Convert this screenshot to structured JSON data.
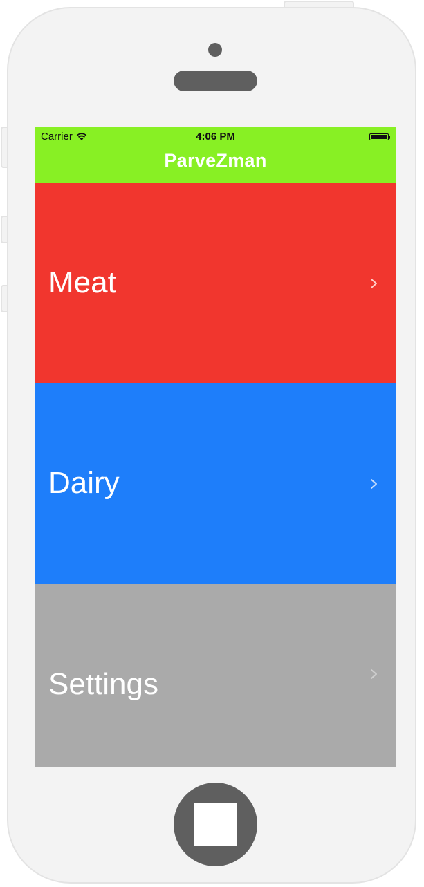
{
  "status_bar": {
    "carrier": "Carrier",
    "time": "4:06 PM",
    "wifi_icon": "wifi-icon",
    "battery_icon": "battery-icon"
  },
  "nav": {
    "title": "ParveZman",
    "color": "#88f024"
  },
  "rows": [
    {
      "label": "Meat",
      "color": "#f1362e",
      "icon": "chevron-right-icon"
    },
    {
      "label": "Dairy",
      "color": "#1e7efa",
      "icon": "chevron-right-icon"
    },
    {
      "label": "Settings",
      "color": "#aaaaaa",
      "icon": "chevron-right-icon"
    }
  ],
  "device": {
    "frame_color": "#f3f3f3",
    "hardware_color": "#5f5f5f"
  }
}
